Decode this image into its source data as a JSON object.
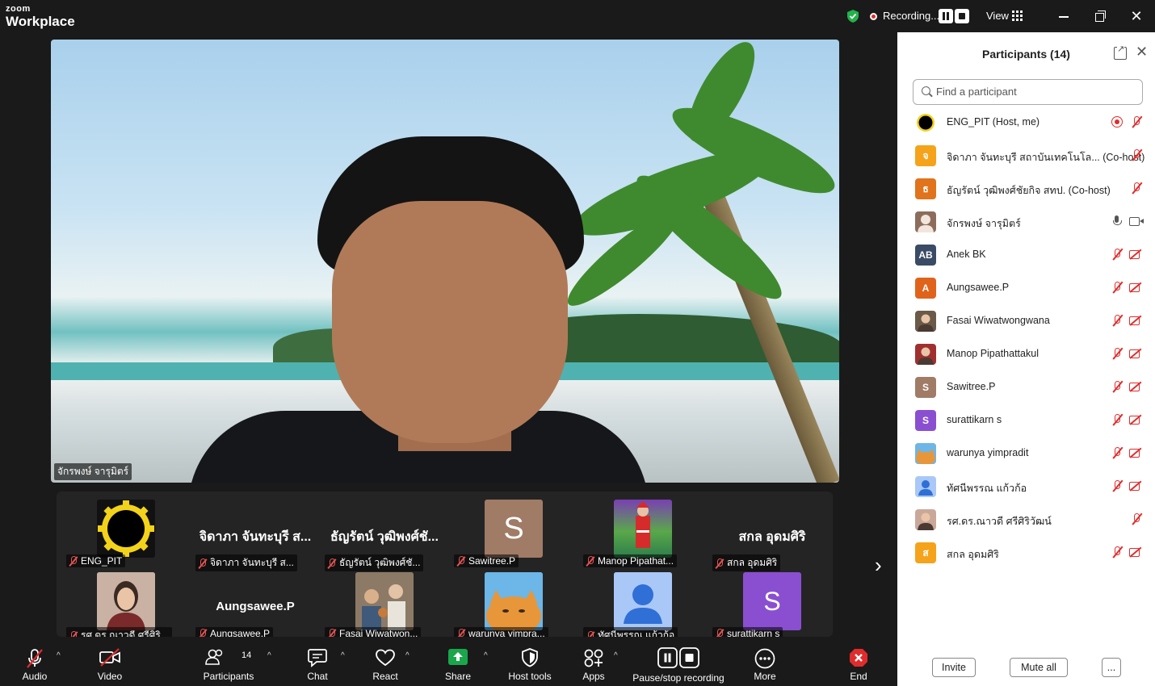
{
  "app": {
    "logo_top": "zoom",
    "logo_bottom": "Workplace"
  },
  "titlebar": {
    "recording_label": "Recording...",
    "view_label": "View"
  },
  "main_video": {
    "speaker_name": "จักรพงษ์ จารุมิตร์"
  },
  "gallery": {
    "row1": [
      {
        "name": "ENG_PIT",
        "type": "image",
        "icon": "gear-logo"
      },
      {
        "name": "จิดาภา จันทะบุรี ส...",
        "big": "จิดาภา จันทะบุรี ส...",
        "type": "text"
      },
      {
        "name": "ธัญรัตน์ วุฒิพงศ์ชั...",
        "big": "ธัญรัตน์ วุฒิพงศ์ชั...",
        "type": "text"
      },
      {
        "name": "Sawitree.P",
        "letter": "S",
        "color": "#a07b66",
        "type": "letter"
      },
      {
        "name": "Manop Pipathat...",
        "type": "image",
        "icon": "santa-photo"
      },
      {
        "name": "สกล อุดมศิริ",
        "big": "สกล อุดมศิริ",
        "type": "text"
      }
    ],
    "row2": [
      {
        "name": "รศ.ดร.ณาวดี ศรีศิริ...",
        "type": "image",
        "icon": "portrait-photo"
      },
      {
        "name": "Aungsawee.P",
        "big": "Aungsawee.P",
        "type": "text"
      },
      {
        "name": "Fasai Wiwatwon...",
        "type": "image",
        "icon": "group-photo"
      },
      {
        "name": "warunya yimpra...",
        "type": "image",
        "icon": "cat-photo"
      },
      {
        "name": "ทัศนีพรรณ แก้วก้อ",
        "type": "image",
        "icon": "default-avatar"
      },
      {
        "name": "surattikarn s",
        "letter": "S",
        "color": "#8a4fd1",
        "type": "letter"
      }
    ]
  },
  "panel": {
    "title": "Participants (14)",
    "search_placeholder": "Find a participant",
    "participants": [
      {
        "name": "ENG_PIT (Host, me)",
        "avatar": "gear",
        "color": "#111111",
        "status": "recording"
      },
      {
        "name": "จิดาภา จันทะบุรี สถาบันเทคโนโล... (Co-host)",
        "letter": "จ",
        "color": "#f5a31a",
        "status": "mic-off"
      },
      {
        "name": "ธัญรัตน์ วุฒิพงศ์ชัยกิจ สทป. (Co-host)",
        "letter": "ธ",
        "color": "#e0731b",
        "status": "mic-off"
      },
      {
        "name": "จักรพงษ์ จารุมิตร์",
        "avatar": "person",
        "color": "#8c6d5c",
        "status": "mic-on-cam-on"
      },
      {
        "name": "Anek BK",
        "letter": "AB",
        "color": "#3b4b66",
        "status": "both-off"
      },
      {
        "name": "Aungsawee.P",
        "letter": "A",
        "color": "#e0631b",
        "status": "both-off"
      },
      {
        "name": "Fasai Wiwatwongwana",
        "avatar": "photo",
        "color": "#6b5a48",
        "status": "both-off"
      },
      {
        "name": "Manop Pipathattakul",
        "avatar": "photo",
        "color": "#a03030",
        "status": "both-off"
      },
      {
        "name": "Sawitree.P",
        "letter": "S",
        "color": "#a07b66",
        "status": "both-off"
      },
      {
        "name": "surattikarn s",
        "letter": "S",
        "color": "#8a4fd1",
        "status": "both-off"
      },
      {
        "name": "warunya yimpradit",
        "avatar": "cat",
        "color": "#e8963a",
        "status": "both-off"
      },
      {
        "name": "ทัศนีพรรณ แก้วก้อ",
        "avatar": "default",
        "color": "#7aa6f0",
        "status": "both-off"
      },
      {
        "name": "รศ.ดร.ณาวดี ศรีศิริวัฒน์",
        "avatar": "photo",
        "color": "#c9a89a",
        "status": "mic-off"
      },
      {
        "name": "สกล อุดมศิริ",
        "letter": "ส",
        "color": "#f5a31a",
        "status": "both-off"
      }
    ],
    "invite_label": "Invite",
    "mute_all_label": "Mute all",
    "more_label": "..."
  },
  "toolbar": {
    "audio": "Audio",
    "video": "Video",
    "participants": "Participants",
    "participants_count": "14",
    "chat": "Chat",
    "react": "React",
    "share": "Share",
    "host_tools": "Host tools",
    "apps": "Apps",
    "pause_stop": "Pause/stop recording",
    "more": "More",
    "end": "End"
  },
  "colors": {
    "share_green": "#1aa64b",
    "end_red": "#e02c2c",
    "muted_red": "#e55353"
  }
}
